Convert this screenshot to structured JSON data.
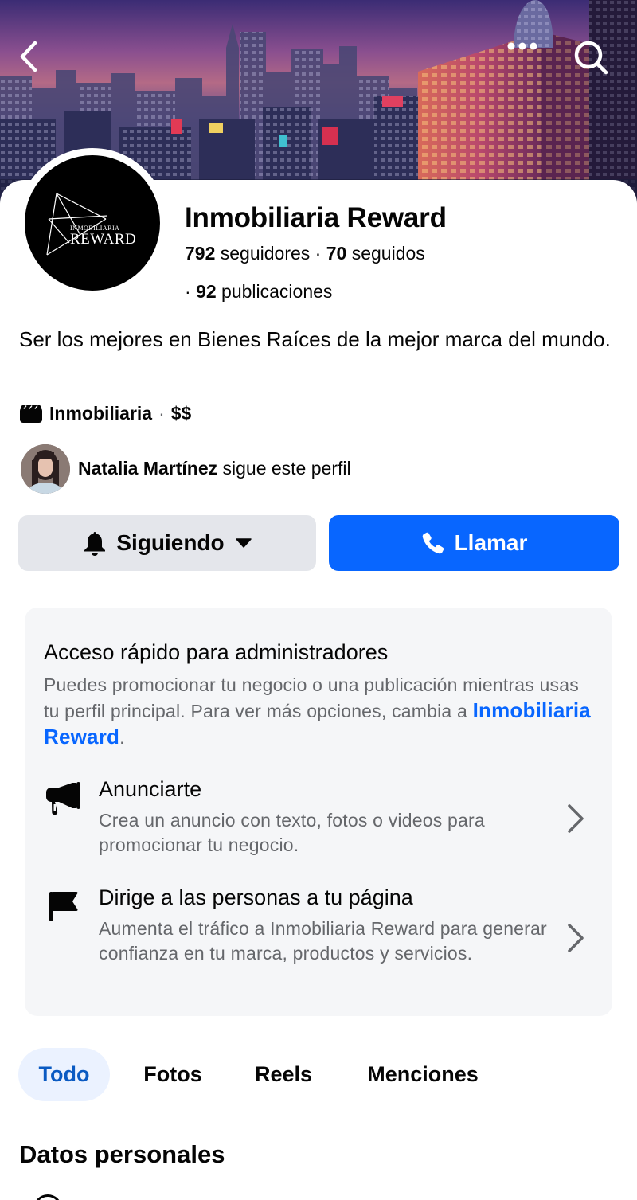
{
  "header": {
    "back_icon": "chevron-left-icon",
    "more_icon": "more-dots-icon",
    "search_icon": "search-icon"
  },
  "profile": {
    "name": "Inmobiliaria Reward",
    "logo_small_text": "INMOBILIARIA",
    "logo_big_text": "REWARD",
    "followers_count": "792",
    "followers_label": " seguidores · ",
    "following_count": "70",
    "following_label": " seguidos",
    "posts_prefix": "· ",
    "posts_count": "92",
    "posts_label": " publicaciones",
    "bio": "Ser los mejores en Bienes Raíces de la mejor marca del mundo.",
    "category": "Inmobiliaria",
    "category_separator": "·",
    "price_range": "$$",
    "mutual_follower_name": "Natalia Martínez",
    "mutual_follower_text": " sigue este perfil"
  },
  "actions": {
    "following_label": "Siguiendo",
    "call_label": "Llamar"
  },
  "admin": {
    "title": "Acceso rápido para administradores",
    "description": "Puedes promocionar tu negocio o una publicación mientras usas tu perfil principal. Para ver más opciones, cambia a ",
    "link_text": "Inmobiliaria Reward",
    "link_suffix": ".",
    "items": [
      {
        "title": "Anunciarte",
        "description": "Crea un anuncio con texto, fotos o videos para promocionar tu negocio.",
        "icon": "megaphone-icon"
      },
      {
        "title": "Dirige a las personas a tu página",
        "description": "Aumenta el tráfico a Inmobiliaria Reward para generar confianza en tu marca, productos y servicios.",
        "icon": "flag-icon"
      }
    ]
  },
  "tabs": [
    {
      "label": "Todo",
      "active": true
    },
    {
      "label": "Fotos",
      "active": false
    },
    {
      "label": "Reels",
      "active": false
    },
    {
      "label": "Menciones",
      "active": false
    }
  ],
  "sections": {
    "personal_info_title": "Datos personales"
  },
  "colors": {
    "primary_blue": "#0866ff",
    "link_blue": "#0a5ac2",
    "active_tab_bg": "#ebf2ff",
    "secondary_button_bg": "#e4e6eb",
    "muted_text": "#65676b",
    "card_bg": "#f5f6f8"
  }
}
